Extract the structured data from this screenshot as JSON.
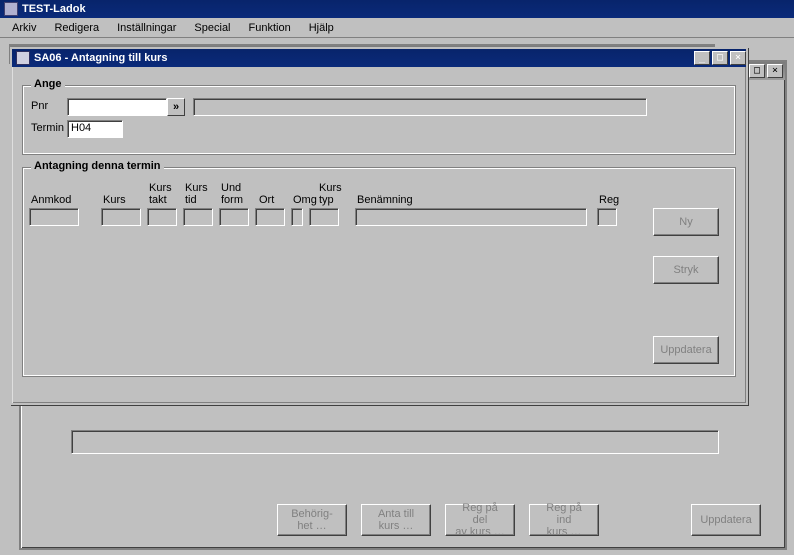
{
  "app": {
    "title": "TEST-Ladok"
  },
  "menubar": {
    "items": [
      "Arkiv",
      "Redigera",
      "Inställningar",
      "Special",
      "Funktion",
      "Hjälp"
    ]
  },
  "window": {
    "title": "SA06 - Antagning till kurs",
    "ange": {
      "legend": "Ange",
      "pnr_label": "Pnr",
      "pnr_value": "",
      "arrow_glyph": "»",
      "name_value": "",
      "termin_label": "Termin",
      "termin_value": "H04"
    },
    "antagning": {
      "legend": "Antagning denna termin",
      "cols": {
        "anmkod": "Anmkod",
        "kurs": "Kurs",
        "kurstakt1": "Kurs",
        "kurstakt2": "takt",
        "kurstid1": "Kurs",
        "kurstid2": "tid",
        "undform1": "Und",
        "undform2": "form",
        "ort": "Ort",
        "omg": "Omg",
        "kurstyp1": "Kurs",
        "kurstyp2": "typ",
        "benamning": "Benämning",
        "reg": "Reg"
      },
      "buttons": {
        "ny": "Ny",
        "stryk": "Stryk",
        "uppdatera": "Uppdatera"
      }
    }
  },
  "bottom": {
    "status_value": "",
    "buttons": {
      "behorig1": "Behörig-",
      "behorig2": "het …",
      "anta1": "Anta till",
      "anta2": "kurs …",
      "regdel1": "Reg på del",
      "regdel2": "av kurs …",
      "regind1": "Reg på ind",
      "regind2": "kurs …",
      "uppdatera": "Uppdatera"
    }
  }
}
